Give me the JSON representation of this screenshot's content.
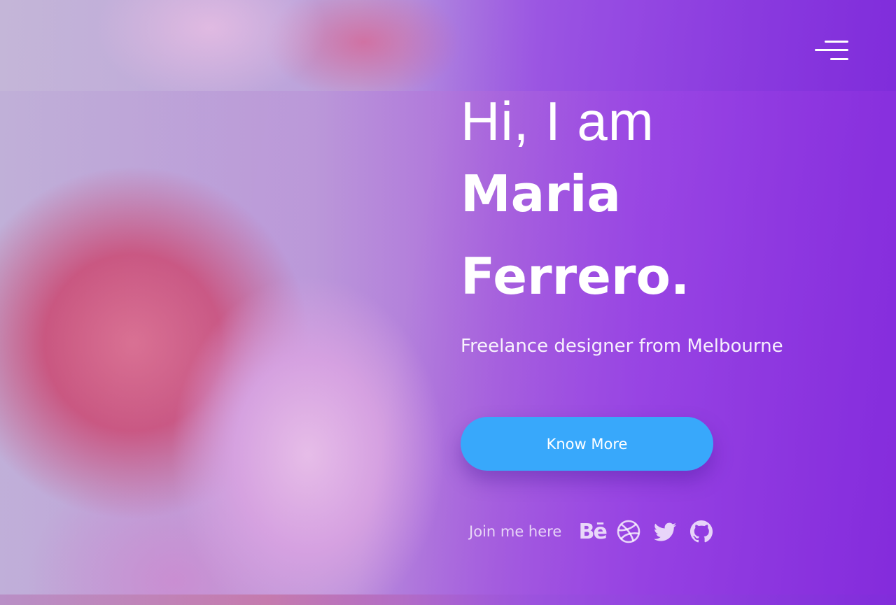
{
  "header": {
    "menu_icon": "hamburger-menu-icon"
  },
  "hero": {
    "greeting": "Hi, I am",
    "first_name": "Maria",
    "last_name": "Ferrero.",
    "tagline": "Freelance designer from Melbourne",
    "cta_label": "Know More"
  },
  "social": {
    "label": "Join me here",
    "behance_glyph": "Bē",
    "icons": [
      "behance-icon",
      "dribbble-icon",
      "twitter-icon",
      "github-icon"
    ]
  },
  "colors": {
    "accent_button": "#38a8fb",
    "gradient_end": "#8a36dc",
    "text": "#ffffff"
  }
}
